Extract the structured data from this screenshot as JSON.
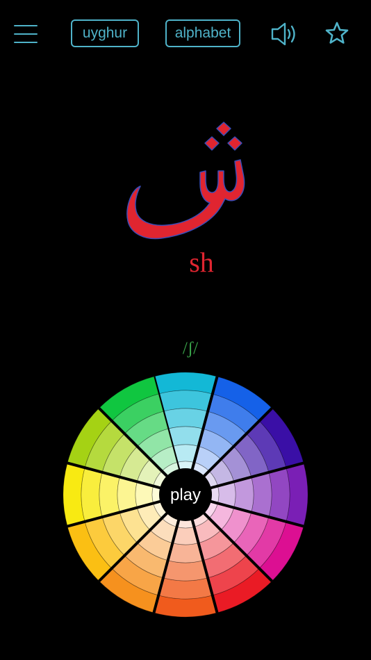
{
  "header": {
    "menu_icon": "hamburger-menu-icon",
    "language_label": "uyghur",
    "alphabet_label": "alphabet",
    "sound_icon": "speaker-icon",
    "favorite_icon": "star-outline-icon",
    "accent_color": "#4fb3c9"
  },
  "letter": {
    "glyph": "ش",
    "romanization": "sh",
    "ipa": "/ʃ/",
    "glyph_color": "#e02530",
    "ipa_color": "#3aa54a"
  },
  "wheel": {
    "play_label": "play",
    "segment_colors": [
      "#13b8d6",
      "#1561e8",
      "#3a0fa6",
      "#7a1fb5",
      "#dc0f92",
      "#ea1b25",
      "#f05b1d",
      "#f6911e",
      "#fbbf13",
      "#f8ea12",
      "#a5d214",
      "#10c640"
    ]
  }
}
